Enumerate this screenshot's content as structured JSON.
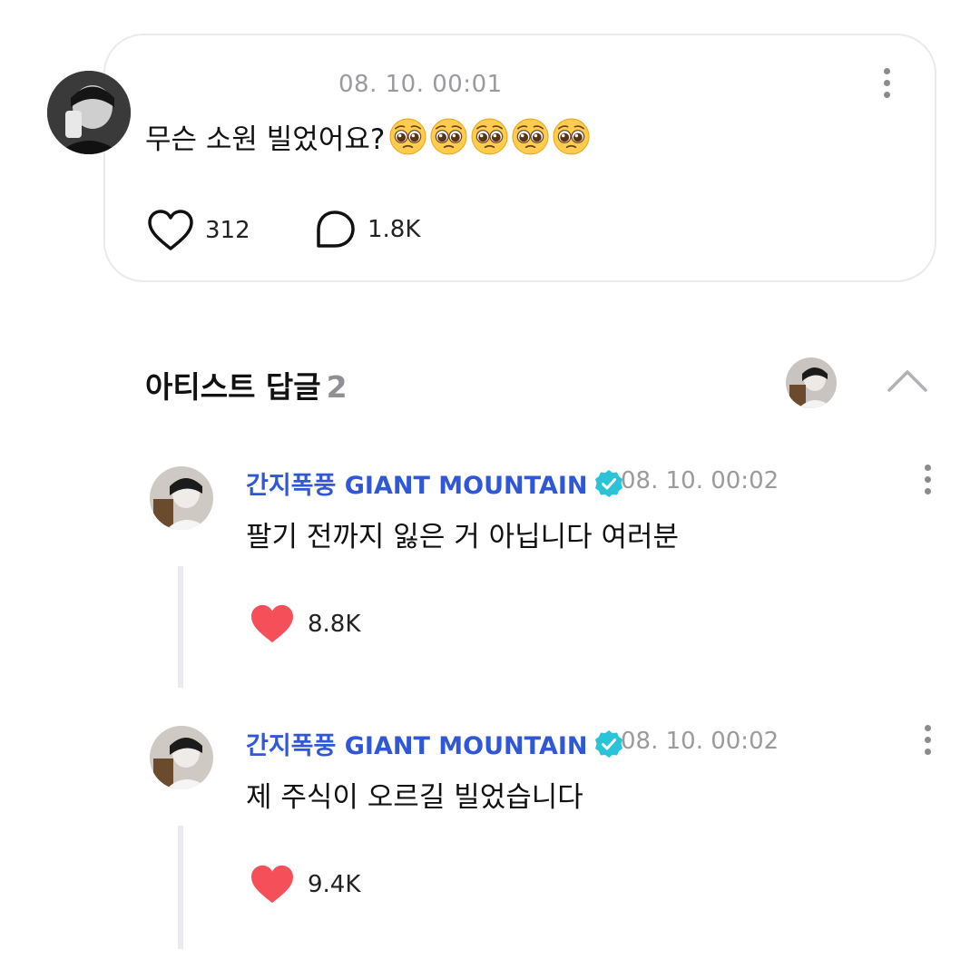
{
  "post": {
    "time": "08. 10. 00:01",
    "text": "무슨 소원 빌었어요?",
    "emoji_count": 5,
    "emoji_name": "pleading-face-icon",
    "likes": "312",
    "comments": "1.8K"
  },
  "section": {
    "title": "아티스트 답글",
    "count": "2"
  },
  "replies": [
    {
      "name": "간지폭풍 GIANT MOUNTAIN",
      "time": "08. 10. 00:02",
      "text": "팔기 전까지 잃은 거 아닙니다 여러분",
      "likes": "8.8K"
    },
    {
      "name": "간지폭풍 GIANT MOUNTAIN",
      "time": "08. 10. 00:02",
      "text": "제 주식이 오르길 빌었습니다",
      "likes": "9.4K"
    }
  ],
  "colors": {
    "accent_name": "#2f57d6",
    "verified_badge": "#2bc3d8",
    "like_filled": "#f5505a",
    "muted_text": "#9a9a9f"
  }
}
